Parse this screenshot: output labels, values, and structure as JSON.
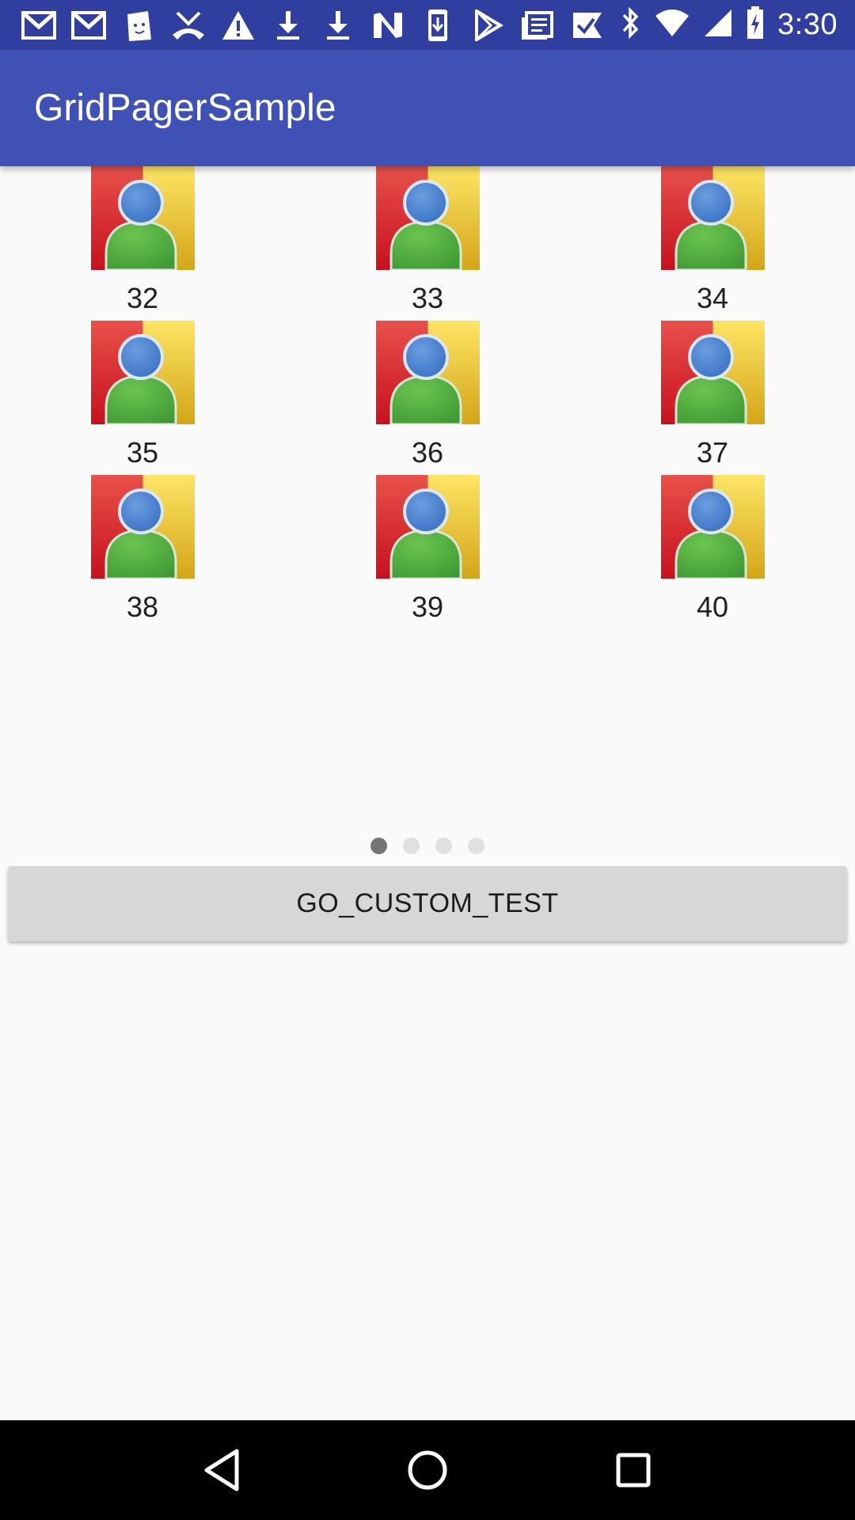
{
  "status_bar": {
    "time": "3:30",
    "icons": [
      "gmail-icon",
      "gmail-icon",
      "clipboard-icon",
      "missed-call-icon",
      "warning-icon",
      "download-icon",
      "download-icon",
      "n-icon",
      "phone-download-icon",
      "play-store-icon",
      "news-icon",
      "check-flag-icon"
    ],
    "right_icons": [
      "bluetooth-icon",
      "wifi-icon",
      "signal-icon",
      "battery-charging-icon"
    ]
  },
  "app_bar": {
    "title": "GridPagerSample"
  },
  "grid": {
    "items": [
      {
        "label": "32"
      },
      {
        "label": "33"
      },
      {
        "label": "34"
      },
      {
        "label": "35"
      },
      {
        "label": "36"
      },
      {
        "label": "37"
      },
      {
        "label": "38"
      },
      {
        "label": "39"
      },
      {
        "label": "40"
      }
    ]
  },
  "pager": {
    "page_count": 4,
    "current_page": 1
  },
  "button": {
    "label": "GO_CUSTOM_TEST"
  },
  "colors": {
    "status_bar": "#303f9f",
    "app_bar": "#3f51b5",
    "background": "#fafafa",
    "button": "#d6d7d7",
    "indicator_active": "#757575",
    "indicator_inactive": "#e0e0e0"
  }
}
